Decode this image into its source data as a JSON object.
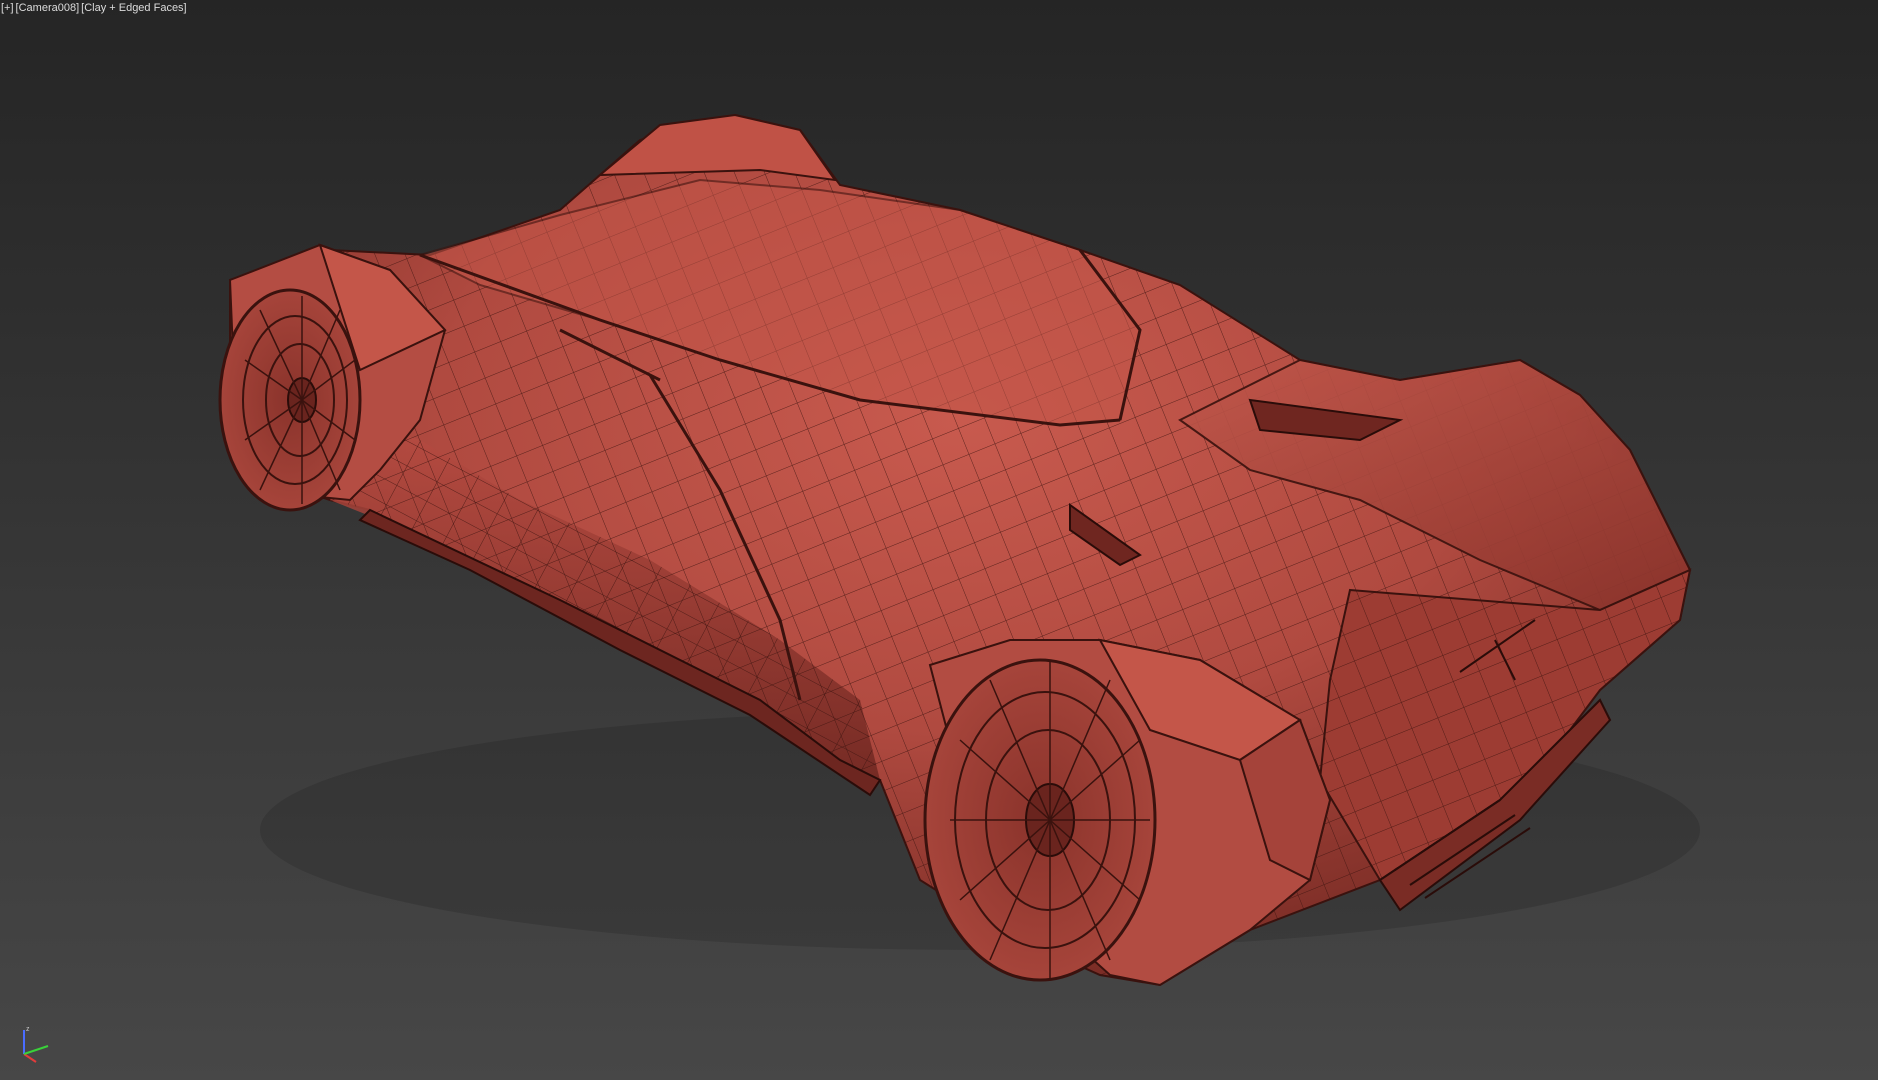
{
  "viewport": {
    "label": {
      "plus_menu": "[+]",
      "camera_menu": "[Camera008]",
      "shading_menu": "[Clay + Edged Faces]"
    },
    "axis_gizmo": {
      "z_label": "z",
      "z_color": "#4a6cff",
      "x_color": "#e23b3b",
      "y_color": "#3ad13a"
    },
    "colors": {
      "background_top": "#252525",
      "background_bottom": "#474747",
      "clay": "#b04a40",
      "clay_light": "#c85a4e",
      "clay_dark": "#7a2c25",
      "edge": "#3a120e"
    }
  }
}
